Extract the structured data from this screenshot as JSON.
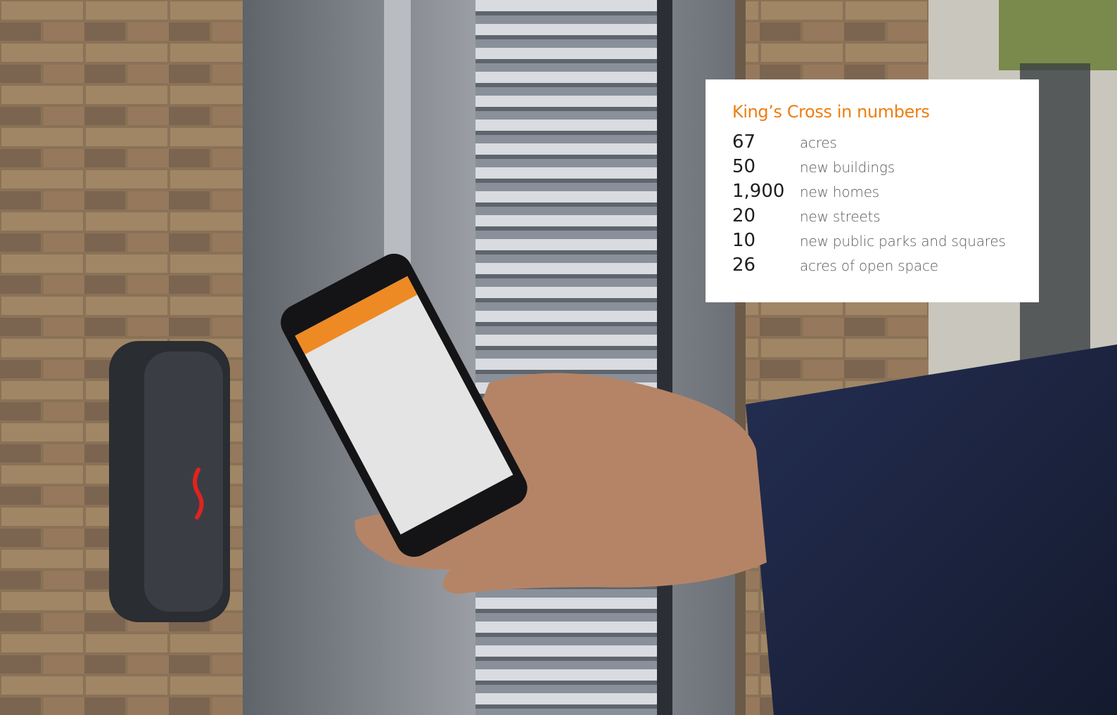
{
  "card": {
    "title": "King’s Cross in numbers",
    "stats": [
      {
        "number": "67",
        "label": "acres"
      },
      {
        "number": "50",
        "label": "new buildings"
      },
      {
        "number": "1,900",
        "label": "new homes"
      },
      {
        "number": "20",
        "label": "new streets"
      },
      {
        "number": "10",
        "label": "new public parks and squares"
      },
      {
        "number": "26",
        "label": "acres of open space"
      }
    ]
  },
  "colors": {
    "accent": "#ee7d11",
    "card_bg": "#ffffff",
    "phone_header": "#ee8a24",
    "reader_led": "#e0231f",
    "sleeve": "#1c2540"
  }
}
